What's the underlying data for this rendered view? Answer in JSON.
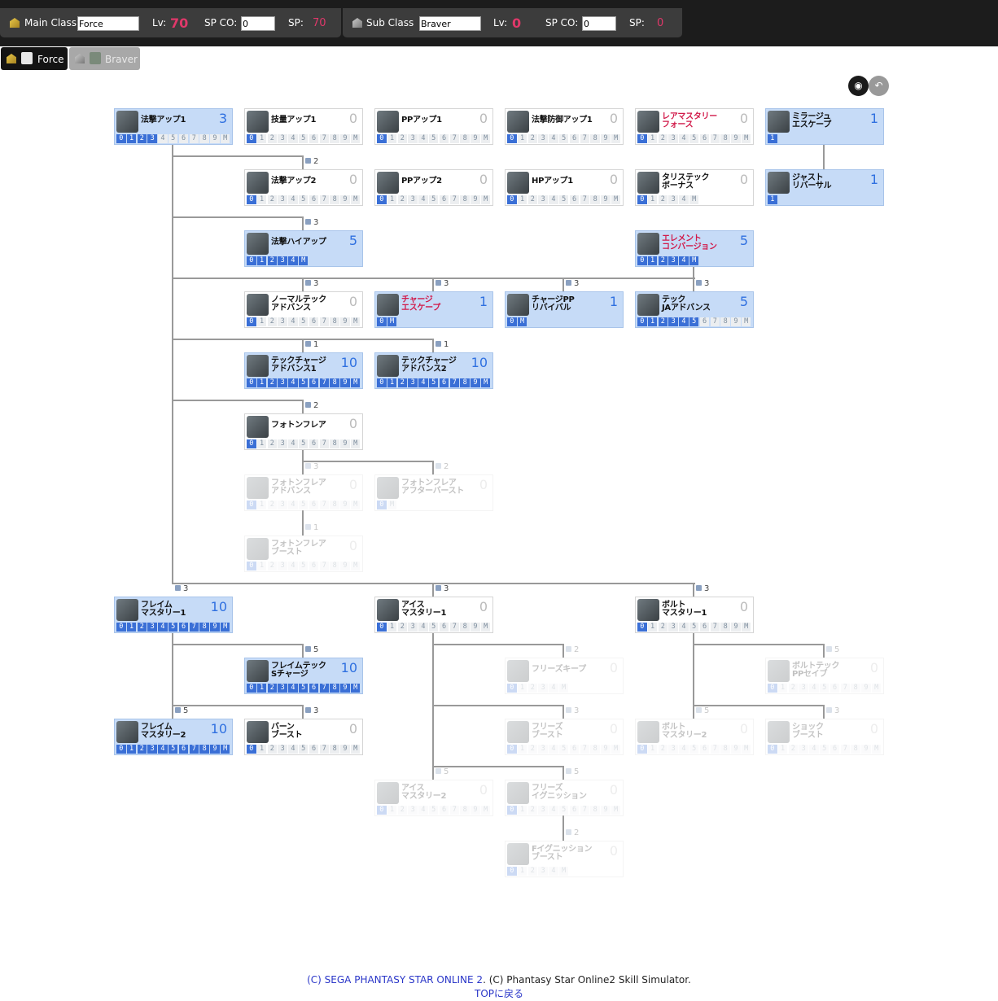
{
  "main_class": {
    "label": "Main Class",
    "value": "Force",
    "lv_label": "Lv:",
    "lv": "70",
    "spco_label": "SP CO:",
    "spco": "0",
    "sp_label": "SP:",
    "sp": "70"
  },
  "sub_class": {
    "label": "Sub  Class",
    "value": "Braver",
    "lv_label": "Lv:",
    "lv": "0",
    "spco_label": "SP CO:",
    "spco": "0",
    "sp_label": "SP:",
    "sp": "0"
  },
  "tabs": [
    {
      "label": "Force",
      "active": true
    },
    {
      "label": "Braver",
      "active": false
    }
  ],
  "colors": {
    "accent": "#e0386a",
    "selected": "#3a6fd6",
    "learned_bg": "#c6dbf7"
  },
  "skills": [
    {
      "name": "法撃アップ1",
      "lv": "3",
      "max": 10,
      "c": 0,
      "r": 0,
      "state": "on",
      "red": false
    },
    {
      "name": "技量アップ1",
      "lv": "0",
      "max": 10,
      "c": 1,
      "r": 0,
      "state": "off",
      "red": false
    },
    {
      "name": "PPアップ1",
      "lv": "0",
      "max": 10,
      "c": 2,
      "r": 0,
      "state": "off",
      "red": false
    },
    {
      "name": "法撃防御アップ1",
      "lv": "0",
      "max": 10,
      "c": 3,
      "r": 0,
      "state": "off",
      "red": false
    },
    {
      "name": "レアマスタリー\nフォース",
      "lv": "0",
      "max": 10,
      "c": 4,
      "r": 0,
      "state": "off",
      "red": true
    },
    {
      "name": "ミラージュ\nエスケープ",
      "lv": "1",
      "max": 1,
      "c": 5,
      "r": 0,
      "state": "on",
      "red": false,
      "single": true
    },
    {
      "name": "法撃アップ2",
      "lv": "0",
      "max": 10,
      "c": 1,
      "r": 1,
      "state": "off",
      "red": false
    },
    {
      "name": "PPアップ2",
      "lv": "0",
      "max": 10,
      "c": 2,
      "r": 1,
      "state": "off",
      "red": false
    },
    {
      "name": "HPアップ1",
      "lv": "0",
      "max": 10,
      "c": 3,
      "r": 1,
      "state": "off",
      "red": false
    },
    {
      "name": "タリステック\nボーナス",
      "lv": "0",
      "max": 5,
      "c": 4,
      "r": 1,
      "state": "off",
      "red": false
    },
    {
      "name": "ジャスト\nリバーサル",
      "lv": "1",
      "max": 1,
      "c": 5,
      "r": 1,
      "state": "on",
      "red": false,
      "single": true
    },
    {
      "name": "法撃ハイアップ",
      "lv": "5",
      "max": 5,
      "c": 1,
      "r": 2,
      "state": "on",
      "red": false
    },
    {
      "name": "エレメント\nコンバージョン",
      "lv": "5",
      "max": 5,
      "c": 4,
      "r": 2,
      "state": "on",
      "red": true
    },
    {
      "name": "ノーマルテック\nアドバンス",
      "lv": "0",
      "max": 10,
      "c": 1,
      "r": 3,
      "state": "off",
      "red": false
    },
    {
      "name": "チャージ\nエスケープ",
      "lv": "1",
      "max": 1,
      "c": 2,
      "r": 3,
      "state": "on",
      "red": true
    },
    {
      "name": "チャージPP\nリバイバル",
      "lv": "1",
      "max": 1,
      "c": 3,
      "r": 3,
      "state": "on",
      "red": false
    },
    {
      "name": "テック\nJAアドバンス",
      "lv": "5",
      "max": 10,
      "c": 4,
      "r": 3,
      "state": "on",
      "red": false
    },
    {
      "name": "テックチャージ\nアドバンス1",
      "lv": "10",
      "max": 10,
      "c": 1,
      "r": 4,
      "state": "on",
      "red": false
    },
    {
      "name": "テックチャージ\nアドバンス2",
      "lv": "10",
      "max": 10,
      "c": 2,
      "r": 4,
      "state": "on",
      "red": false
    },
    {
      "name": "フォトンフレア",
      "lv": "0",
      "max": 10,
      "c": 1,
      "r": 5,
      "state": "off",
      "red": false
    },
    {
      "name": "フォトンフレア\nアドバンス",
      "lv": "0",
      "max": 10,
      "c": 1,
      "r": 6,
      "state": "dim",
      "red": false
    },
    {
      "name": "フォトンフレア\nアフターバースト",
      "lv": "0",
      "max": 1,
      "c": 2,
      "r": 6,
      "state": "dim",
      "red": false
    },
    {
      "name": "フォトンフレア\nブースト",
      "lv": "0",
      "max": 10,
      "c": 1,
      "r": 7,
      "state": "dim",
      "red": false
    },
    {
      "name": "フレイム\nマスタリー1",
      "lv": "10",
      "max": 10,
      "c": 0,
      "r": 8,
      "state": "on",
      "red": false
    },
    {
      "name": "アイス\nマスタリー1",
      "lv": "0",
      "max": 10,
      "c": 2,
      "r": 8,
      "state": "off",
      "red": false
    },
    {
      "name": "ボルト\nマスタリー1",
      "lv": "0",
      "max": 10,
      "c": 4,
      "r": 8,
      "state": "off",
      "red": false
    },
    {
      "name": "フレイムテック\nSチャージ",
      "lv": "10",
      "max": 10,
      "c": 1,
      "r": 9,
      "state": "on",
      "red": false
    },
    {
      "name": "フリーズキープ",
      "lv": "0",
      "max": 5,
      "c": 3,
      "r": 9,
      "state": "dim",
      "red": false
    },
    {
      "name": "ボルトテック\nPPセイブ",
      "lv": "0",
      "max": 10,
      "c": 5,
      "r": 9,
      "state": "dim",
      "red": false
    },
    {
      "name": "フレイム\nマスタリー2",
      "lv": "10",
      "max": 10,
      "c": 0,
      "r": 10,
      "state": "on",
      "red": false
    },
    {
      "name": "バーン\nブースト",
      "lv": "0",
      "max": 10,
      "c": 1,
      "r": 10,
      "state": "off",
      "red": false
    },
    {
      "name": "フリーズ\nブースト",
      "lv": "0",
      "max": 10,
      "c": 3,
      "r": 10,
      "state": "dim",
      "red": false
    },
    {
      "name": "ボルト\nマスタリー2",
      "lv": "0",
      "max": 10,
      "c": 4,
      "r": 10,
      "state": "dim",
      "red": false
    },
    {
      "name": "ショック\nブースト",
      "lv": "0",
      "max": 10,
      "c": 5,
      "r": 10,
      "state": "dim",
      "red": false
    },
    {
      "name": "アイス\nマスタリー2",
      "lv": "0",
      "max": 10,
      "c": 2,
      "r": 11,
      "state": "dim",
      "red": false
    },
    {
      "name": "フリーズ\nイグニッション",
      "lv": "0",
      "max": 10,
      "c": 3,
      "r": 11,
      "state": "dim",
      "red": false
    },
    {
      "name": "Fイグニッション\nブースト",
      "lv": "0",
      "max": 5,
      "c": 3,
      "r": 12,
      "state": "dim",
      "red": false
    }
  ],
  "locks": [
    {
      "n": "2",
      "c": 1,
      "r": 1
    },
    {
      "n": "3",
      "c": 1,
      "r": 2
    },
    {
      "n": "3",
      "c": 1,
      "r": 3
    },
    {
      "n": "3",
      "c": 2,
      "r": 3
    },
    {
      "n": "3",
      "c": 3,
      "r": 3
    },
    {
      "n": "3",
      "c": 4,
      "r": 3
    },
    {
      "n": "1",
      "c": 1,
      "r": 4
    },
    {
      "n": "1",
      "c": 2,
      "r": 4
    },
    {
      "n": "2",
      "c": 1,
      "r": 5
    },
    {
      "n": "3",
      "c": 1,
      "r": 6,
      "dim": true
    },
    {
      "n": "2",
      "c": 2,
      "r": 6,
      "dim": true
    },
    {
      "n": "1",
      "c": 1,
      "r": 7,
      "dim": true
    },
    {
      "n": "3",
      "c": 0,
      "r": 8
    },
    {
      "n": "3",
      "c": 2,
      "r": 8
    },
    {
      "n": "3",
      "c": 4,
      "r": 8
    },
    {
      "n": "5",
      "c": 1,
      "r": 9
    },
    {
      "n": "2",
      "c": 3,
      "r": 9,
      "dim": true
    },
    {
      "n": "5",
      "c": 5,
      "r": 9,
      "dim": true
    },
    {
      "n": "5",
      "c": 0,
      "r": 10
    },
    {
      "n": "3",
      "c": 1,
      "r": 10
    },
    {
      "n": "3",
      "c": 3,
      "r": 10,
      "dim": true
    },
    {
      "n": "5",
      "c": 4,
      "r": 10,
      "dim": true
    },
    {
      "n": "3",
      "c": 5,
      "r": 10,
      "dim": true
    },
    {
      "n": "5",
      "c": 2,
      "r": 11,
      "dim": true
    },
    {
      "n": "5",
      "c": 3,
      "r": 11,
      "dim": true
    },
    {
      "n": "2",
      "c": 3,
      "r": 12,
      "dim": true
    }
  ],
  "footer": {
    "sega": "(C)  SEGA   PHANTASY STAR ONLINE 2",
    "rest": ". (C) Phantasy Star Online2 Skill Simulator.",
    "top_link": "TOPに戻る"
  }
}
